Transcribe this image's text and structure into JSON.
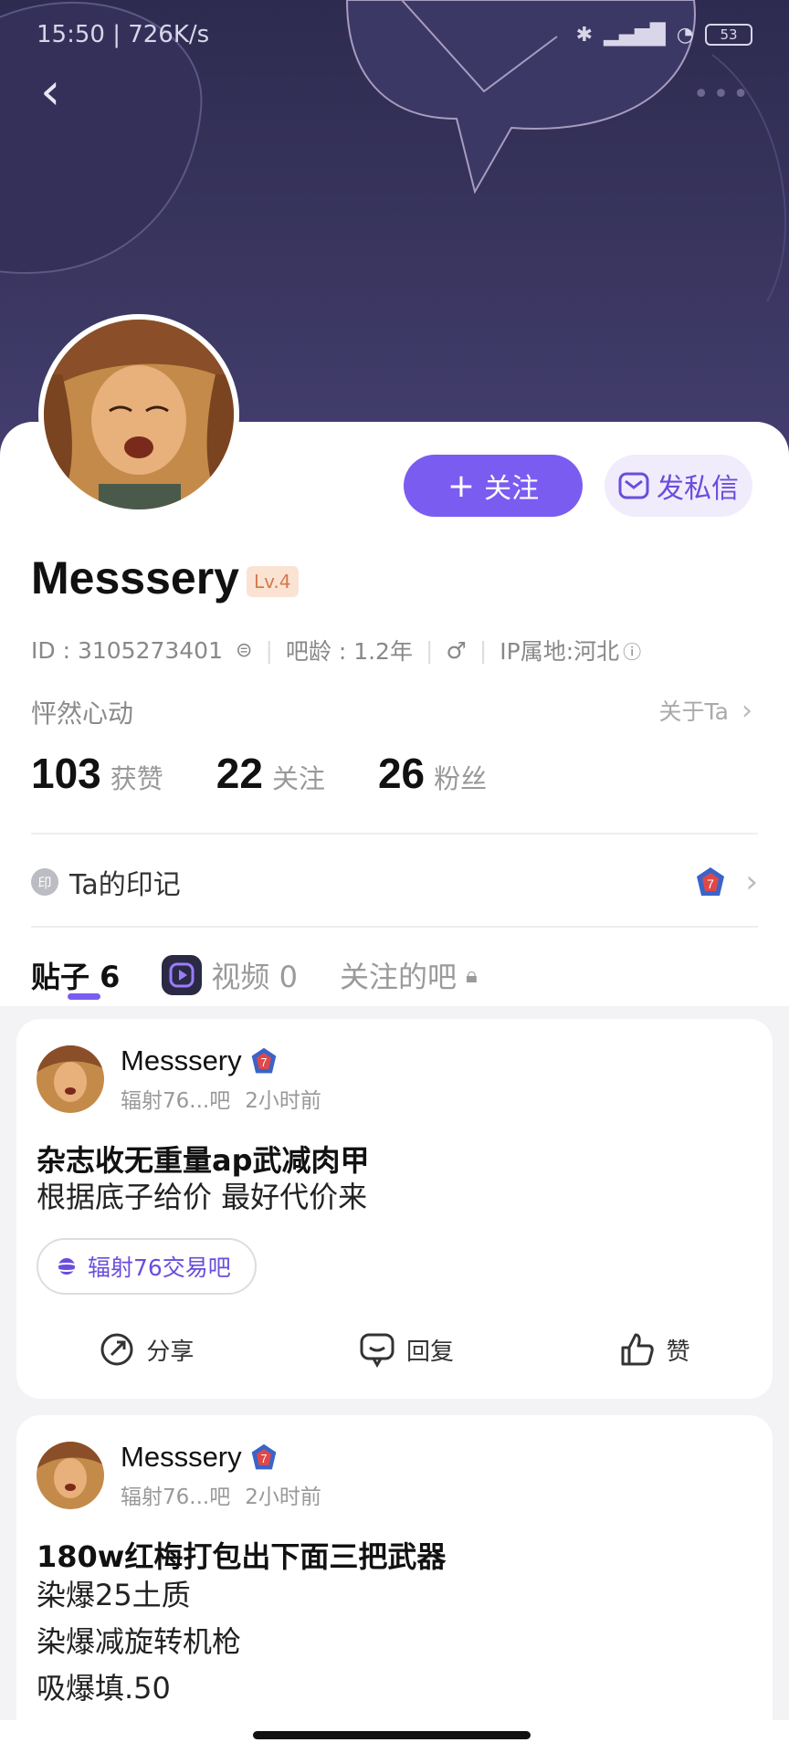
{
  "status_bar": {
    "time_speed": "15:50 | 726K/s",
    "battery": "53"
  },
  "profile": {
    "username": "Messsery",
    "level": "Lv.4",
    "id_text": "ID : 3105273401",
    "bar_age": "吧龄 : 1.2年",
    "gender_symbol": "♂",
    "ip_location": "IP属地:河北",
    "signature": "怦然心动",
    "about_link": "关于Ta",
    "follow_button": "关注",
    "message_button": "发私信",
    "stats": [
      {
        "value": "103",
        "label": "获赞"
      },
      {
        "value": "22",
        "label": "关注"
      },
      {
        "value": "26",
        "label": "粉丝"
      }
    ],
    "marks_label": "Ta的印记",
    "marks_icon_char": "印"
  },
  "tabs": [
    {
      "label": "贴子 6"
    },
    {
      "label": "视频 0"
    },
    {
      "label": "关注的吧"
    }
  ],
  "posts": [
    {
      "author": "Messsery",
      "forum_short": "辐射76...吧",
      "time": "2小时前",
      "title": "杂志收无重量ap武减肉甲",
      "body": [
        "根据底子给价 最好代价来"
      ],
      "forum_tag": "辐射76交易吧"
    },
    {
      "author": "Messsery",
      "forum_short": "辐射76...吧",
      "time": "2小时前",
      "title": "180w红梅打包出下面三把武器",
      "body": [
        "染爆25土质",
        "染爆减旋转机枪",
        "吸爆填.50"
      ]
    }
  ],
  "actions": {
    "share": "分享",
    "reply": "回复",
    "like": "赞"
  },
  "colors": {
    "accent": "#7b5cf0",
    "banner": "#2e2b50"
  }
}
